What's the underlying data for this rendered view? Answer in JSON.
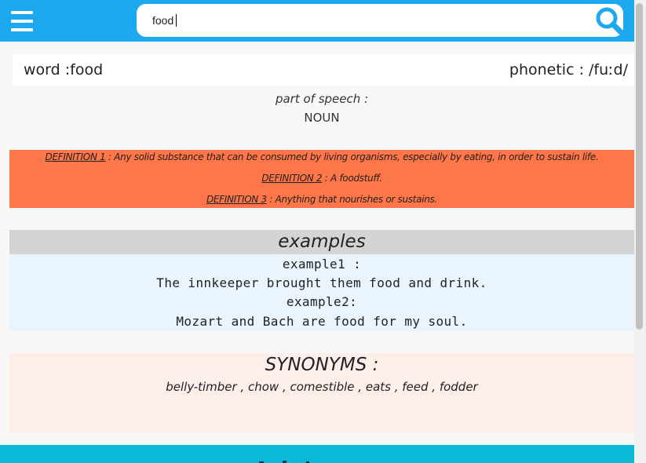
{
  "header": {
    "menu_icon": "hamburger-menu-icon",
    "search": {
      "value": "food",
      "placeholder": ""
    },
    "search_icon": "magnifier-icon",
    "colors": {
      "header_bg": "#1da8ef",
      "search_bg": "#ffffff"
    }
  },
  "word": {
    "text": "word :food",
    "phonetic": "phonetic : /fuːd/"
  },
  "part_of_speech": {
    "label": "part of speech :",
    "value": "NOUN"
  },
  "definitions": {
    "bg_color": "#ff7748",
    "items": [
      {
        "label": "DEFINITION 1",
        "text": " : Any solid substance that can be consumed by living organisms, especially by eating, in order to sustain life."
      },
      {
        "label": "DEFINITION 2",
        "text": " : A foodstuff."
      },
      {
        "label": "DEFINITION 3",
        "text": " : Anything that nourishes or sustains."
      }
    ]
  },
  "examples": {
    "title": "examples",
    "lines": [
      "example1 :",
      "The innkeeper brought them food and drink.",
      "example2:",
      "Mozart and Bach are food for my soul."
    ],
    "head_color": "#d4d4d4",
    "body_color": "#eaf4fc"
  },
  "synonyms": {
    "title": "SYNONYMS :",
    "list": "belly-timber , chow , comestible , eats , feed , fodder",
    "bg_color": "#fdeeea"
  },
  "footer": {
    "bg_color": "#0ab8d8"
  }
}
